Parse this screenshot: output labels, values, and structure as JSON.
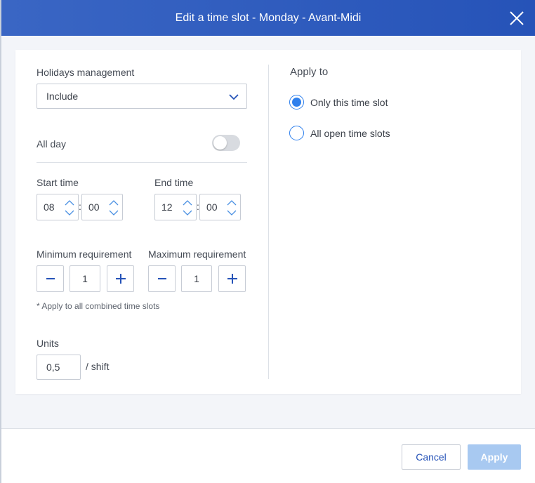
{
  "dialog": {
    "title": "Edit a time slot - Monday - Avant-Midi"
  },
  "form": {
    "holidays_label": "Holidays management",
    "holidays_value": "Include",
    "all_day_label": "All day",
    "all_day_on": false,
    "start_time_label": "Start time",
    "start_hour": "08",
    "start_minute": "00",
    "end_time_label": "End time",
    "end_hour": "12",
    "end_minute": "00",
    "colon": ":",
    "min_req_label": "Minimum requirement",
    "min_req_value": "1",
    "max_req_label": "Maximum requirement",
    "max_req_value": "1",
    "combined_note": "* Apply to all combined time slots",
    "units_label": "Units",
    "units_value": "0,5",
    "units_suffix": "/ shift"
  },
  "apply_to": {
    "title": "Apply to",
    "options": [
      {
        "label": "Only this time slot",
        "selected": true
      },
      {
        "label": "All open time slots",
        "selected": false
      }
    ]
  },
  "footer": {
    "cancel_label": "Cancel",
    "apply_label": "Apply"
  },
  "colors": {
    "header": "#2653b8",
    "accent": "#2f80ed",
    "apply_disabled": "#a8c9f1"
  }
}
